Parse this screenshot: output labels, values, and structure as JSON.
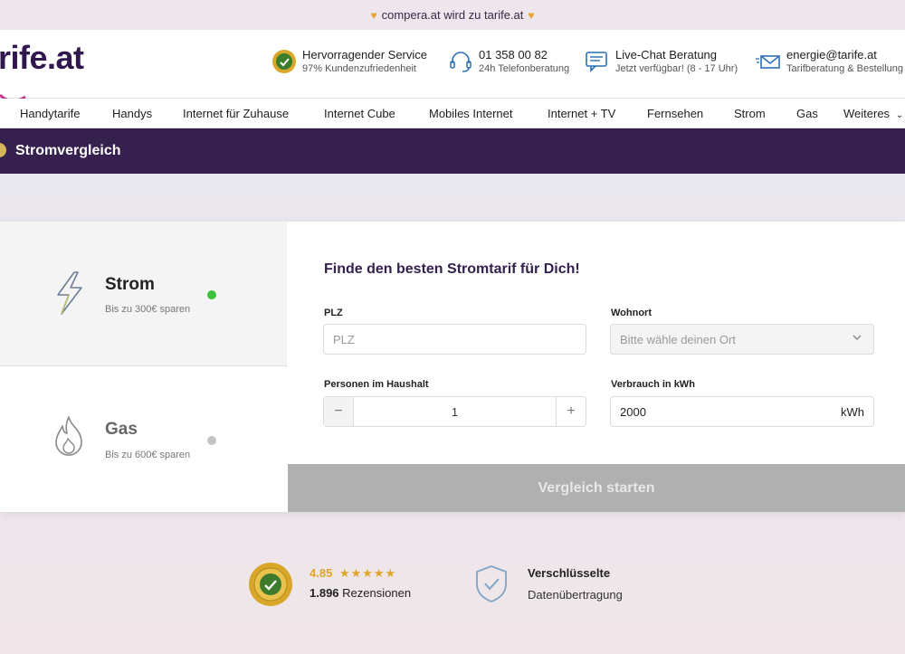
{
  "banner": {
    "text": "compera.at wird zu tarife.at"
  },
  "header": {
    "logo": "tarife.at",
    "logo_visible": "rife.at",
    "service": {
      "title": "Hervorragender Service",
      "sub": "97% Kundenzufriedenheit"
    },
    "phone": {
      "title": "01 358 00 82",
      "sub": "24h Telefonberatung"
    },
    "chat": {
      "title": "Live-Chat Beratung",
      "sub": "Jetzt verfügbar! (8 - 17 Uhr)"
    },
    "email": {
      "title": "energie@tarife.at",
      "sub": "Tarifberatung & Bestellung"
    }
  },
  "nav": {
    "items": [
      "Handytarife",
      "Handys",
      "Internet für Zuhause",
      "Internet Cube",
      "Mobiles Internet",
      "Internet + TV",
      "Fernsehen",
      "Strom",
      "Gas",
      "Weiteres"
    ]
  },
  "subheader": {
    "title": "Stromvergleich"
  },
  "tabs": {
    "strom": {
      "label": "Strom",
      "sub": "Bis zu 300€ sparen",
      "status_color": "#3cc13b"
    },
    "gas": {
      "label": "Gas",
      "sub": "Bis zu 600€ sparen",
      "status_color": "#c4c4c4"
    }
  },
  "form": {
    "heading": "Finde den besten Stromtarif für Dich!",
    "plz_label": "PLZ",
    "plz_placeholder": "PLZ",
    "wohnort_label": "Wohnort",
    "wohnort_placeholder": "Bitte wähle deinen Ort",
    "personen_label": "Personen im Haushalt",
    "personen_value": "1",
    "minus": "−",
    "plus": "+",
    "verbrauch_label": "Verbrauch in kWh",
    "verbrauch_value": "2000",
    "verbrauch_unit": "kWh",
    "cta": "Vergleich starten"
  },
  "trust": {
    "rating": "4.85",
    "stars": "★★★★★",
    "reviews_count": "1.896",
    "reviews_label": "Rezensionen",
    "secure_title": "Verschlüsselte",
    "secure_sub": "Datenübertragung"
  },
  "colors": {
    "brand": "#35204e",
    "accent_gold": "#e0a526",
    "cta_disabled": "#b0b0b0"
  }
}
